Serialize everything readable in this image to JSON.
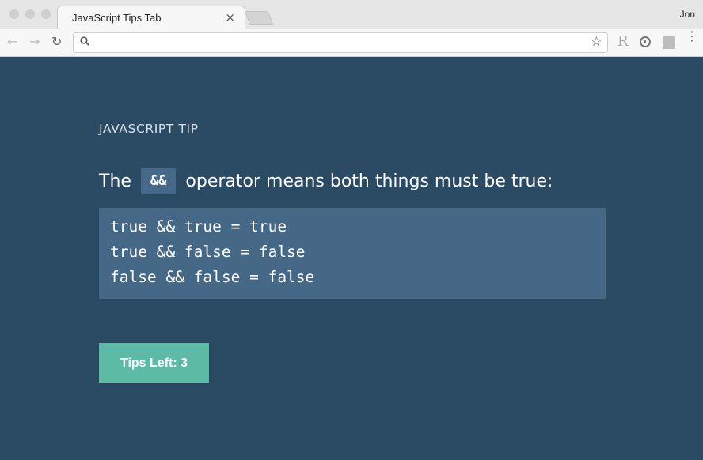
{
  "browser": {
    "tab_title": "JavaScript Tips Tab",
    "tab_close": "×",
    "profile_name": "Jon",
    "address_value": "",
    "address_placeholder": "",
    "icons": {
      "back": "arrow-left-icon",
      "forward": "arrow-right-icon",
      "reload": "reload-icon",
      "search": "search-icon",
      "bookmark": "star-icon",
      "extension_r": "R",
      "extension_info": "info-icon",
      "menu": "more-vertical-icon"
    }
  },
  "tip": {
    "kicker": "JAVASCRIPT TIP",
    "text_before": "The",
    "inline_code": "&&",
    "text_after": "operator means both things must be true:",
    "code_lines": [
      "true && true = true",
      "true && false = false",
      "false && false = false"
    ]
  },
  "actions": {
    "tips_left_label": "Tips Left: 3"
  },
  "colors": {
    "page_bg": "#2b4a63",
    "code_bg": "#456887",
    "button_bg": "#5dbaa4"
  }
}
